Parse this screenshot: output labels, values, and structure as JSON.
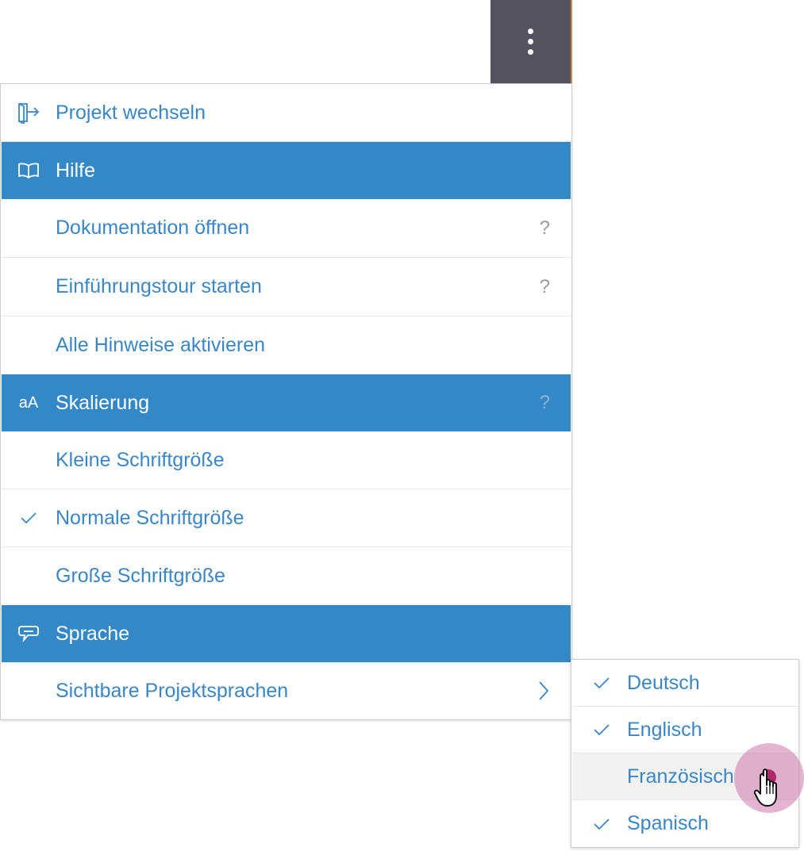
{
  "toolbar": {
    "more_icon": "kebab-vertical-icon"
  },
  "menu": {
    "switch_project": {
      "label": "Projekt wechseln",
      "icon": "exit-door-icon"
    },
    "help_section": {
      "title": "Hilfe",
      "icon": "book-icon",
      "items": [
        {
          "label": "Dokumentation öffnen",
          "help": "?"
        },
        {
          "label": "Einführungstour starten",
          "help": "?"
        },
        {
          "label": "Alle Hinweise aktivieren"
        }
      ]
    },
    "scaling_section": {
      "title": "Skalierung",
      "icon_text": "aA",
      "help": "?",
      "items": [
        {
          "label": "Kleine Schriftgröße",
          "checked": false
        },
        {
          "label": "Normale Schriftgröße",
          "checked": true
        },
        {
          "label": "Große Schriftgröße",
          "checked": false
        }
      ]
    },
    "language_section": {
      "title": "Sprache",
      "icon": "speech-bubble-icon",
      "items": [
        {
          "label": "Sichtbare Projektsprachen",
          "has_submenu": true
        }
      ]
    }
  },
  "submenu": {
    "items": [
      {
        "label": "Deutsch",
        "checked": true
      },
      {
        "label": "Englisch",
        "checked": true
      },
      {
        "label": "Französisch",
        "checked": false,
        "hovered": true
      },
      {
        "label": "Spanisch",
        "checked": true
      }
    ]
  },
  "colors": {
    "accent": "#3388c5",
    "link_text": "#3b86c4",
    "toolbar_bg": "#54525f",
    "help_icon": "#9a9a9a",
    "hover_row": "#f2f2f2",
    "cursor_halo": "#cd78aa"
  }
}
